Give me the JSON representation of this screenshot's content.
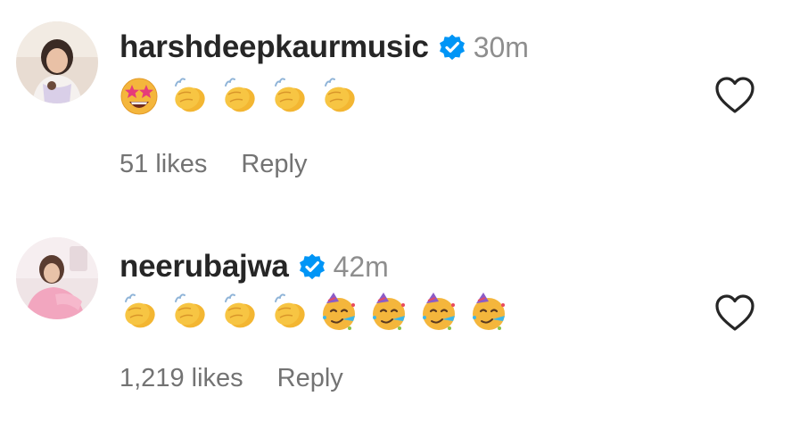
{
  "comments": [
    {
      "username": "harshdeepkaurmusic",
      "verified": true,
      "time": "30m",
      "emojis": [
        "star-struck",
        "clapping-hands",
        "clapping-hands",
        "clapping-hands",
        "clapping-hands"
      ],
      "likes": "51 likes",
      "reply": "Reply"
    },
    {
      "username": "neerubajwa",
      "verified": true,
      "time": "42m",
      "emojis": [
        "clapping-hands",
        "clapping-hands",
        "clapping-hands",
        "clapping-hands",
        "partying-face",
        "partying-face",
        "partying-face",
        "partying-face"
      ],
      "likes": "1,219 likes",
      "reply": "Reply"
    }
  ],
  "colors": {
    "verified_badge": "#0095f6",
    "username": "#262626",
    "secondary_text": "#737373",
    "heart_outline": "#262626"
  }
}
